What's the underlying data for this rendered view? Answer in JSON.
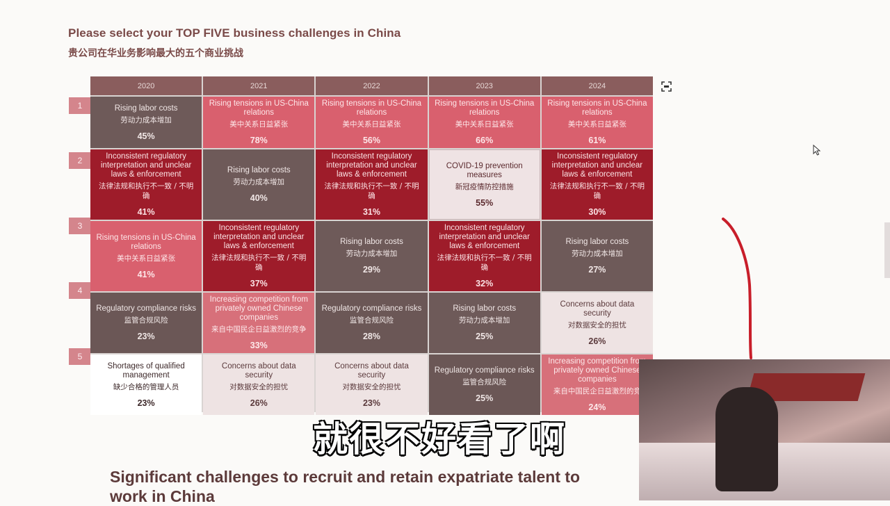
{
  "header": {
    "title": "Please select your TOP FIVE business challenges in China",
    "subtitle": "贵公司在华业务影响最大的五个商业挑战"
  },
  "years": [
    "2020",
    "2021",
    "2022",
    "2023",
    "2024"
  ],
  "ranks": [
    "1",
    "2",
    "3",
    "4",
    "5"
  ],
  "rows": [
    [
      {
        "en": "Rising labor costs",
        "zh": "劳动力成本增加",
        "pct": "45%",
        "style": "labor"
      },
      {
        "en": "Rising tensions in US-China relations",
        "zh": "美中关系日益紧张",
        "pct": "78%",
        "style": "tension"
      },
      {
        "en": "Rising tensions in US-China relations",
        "zh": "美中关系日益紧张",
        "pct": "56%",
        "style": "tension"
      },
      {
        "en": "Rising tensions in US-China relations",
        "zh": "美中关系日益紧张",
        "pct": "66%",
        "style": "tension"
      },
      {
        "en": "Rising tensions in US-China relations",
        "zh": "美中关系日益紧张",
        "pct": "61%",
        "style": "tension"
      }
    ],
    [
      {
        "en": "Inconsistent regulatory interpretation and unclear laws & enforcement",
        "zh": "法律法规和执行不一致 / 不明确",
        "pct": "41%",
        "style": "reg"
      },
      {
        "en": "Rising labor costs",
        "zh": "劳动力成本增加",
        "pct": "40%",
        "style": "labor"
      },
      {
        "en": "Inconsistent regulatory interpretation and unclear laws & enforcement",
        "zh": "法律法规和执行不一致 / 不明确",
        "pct": "31%",
        "style": "reg"
      },
      {
        "en": "COVID-19 prevention measures",
        "zh": "新冠疫情防控措施",
        "pct": "55%",
        "style": "covid"
      },
      {
        "en": "Inconsistent regulatory interpretation and unclear laws & enforcement",
        "zh": "法律法规和执行不一致 / 不明确",
        "pct": "30%",
        "style": "reg"
      }
    ],
    [
      {
        "en": "Rising tensions in US-China relations",
        "zh": "美中关系日益紧张",
        "pct": "41%",
        "style": "tension"
      },
      {
        "en": "Inconsistent regulatory interpretation and unclear laws & enforcement",
        "zh": "法律法规和执行不一致 / 不明确",
        "pct": "37%",
        "style": "reg"
      },
      {
        "en": "Rising labor costs",
        "zh": "劳动力成本增加",
        "pct": "29%",
        "style": "labor"
      },
      {
        "en": "Inconsistent regulatory interpretation and unclear laws & enforcement",
        "zh": "法律法规和执行不一致 / 不明确",
        "pct": "32%",
        "style": "reg"
      },
      {
        "en": "Rising labor costs",
        "zh": "劳动力成本增加",
        "pct": "27%",
        "style": "labor"
      }
    ],
    [
      {
        "en": "Regulatory compliance risks",
        "zh": "监管合规风险",
        "pct": "23%",
        "style": "comp"
      },
      {
        "en": "Increasing competition from privately owned Chinese companies",
        "zh": "来自中国民企日益激烈的竞争",
        "pct": "33%",
        "style": "compet"
      },
      {
        "en": "Regulatory compliance risks",
        "zh": "监管合规风险",
        "pct": "28%",
        "style": "comp"
      },
      {
        "en": "Rising labor costs",
        "zh": "劳动力成本增加",
        "pct": "25%",
        "style": "labor"
      },
      {
        "en": "Concerns about data security",
        "zh": "对数据安全的担忧",
        "pct": "26%",
        "style": "data"
      }
    ],
    [
      {
        "en": "Shortages of qualified management",
        "zh": "缺少合格的管理人员",
        "pct": "23%",
        "style": "short"
      },
      {
        "en": "Concerns about data security",
        "zh": "对数据安全的担忧",
        "pct": "26%",
        "style": "data"
      },
      {
        "en": "Concerns about data security",
        "zh": "对数据安全的担忧",
        "pct": "23%",
        "style": "data"
      },
      {
        "en": "Regulatory compliance risks",
        "zh": "监管合规风险",
        "pct": "25%",
        "style": "comp"
      },
      {
        "en": "Increasing competition from privately owned Chinese companies",
        "zh": "来自中国民企日益激烈的竞",
        "pct": "24%",
        "style": "compet"
      }
    ]
  ],
  "caption": "就很不好看了啊",
  "section": {
    "heading": "Significant challenges to recruit and retain expatriate talent to work in China"
  },
  "icons": {
    "expand": "expand-icon",
    "cursor": "cursor-icon"
  },
  "colors": {
    "labor": "#6e5a59",
    "tension": "#d9606e",
    "regulatory": "#9e1c2a",
    "header": "#8a5d5d",
    "rank": "#d4858c"
  }
}
